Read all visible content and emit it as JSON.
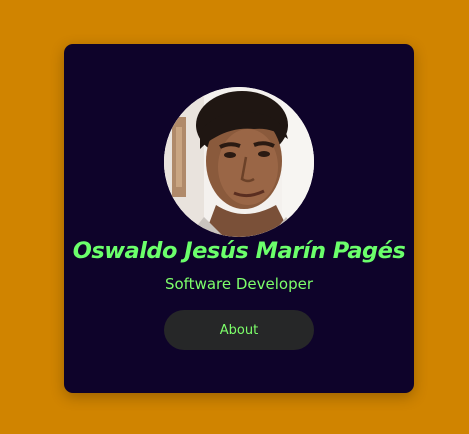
{
  "profile": {
    "name": "Oswaldo Jesús Marín Pagés",
    "role": "Software Developer",
    "avatar_icon": "profile-photo",
    "about_label": "About"
  },
  "colors": {
    "page_background": "#d08400",
    "card_background": "#0e032a",
    "accent_green": "#6bff6b",
    "button_background": "#262728"
  }
}
